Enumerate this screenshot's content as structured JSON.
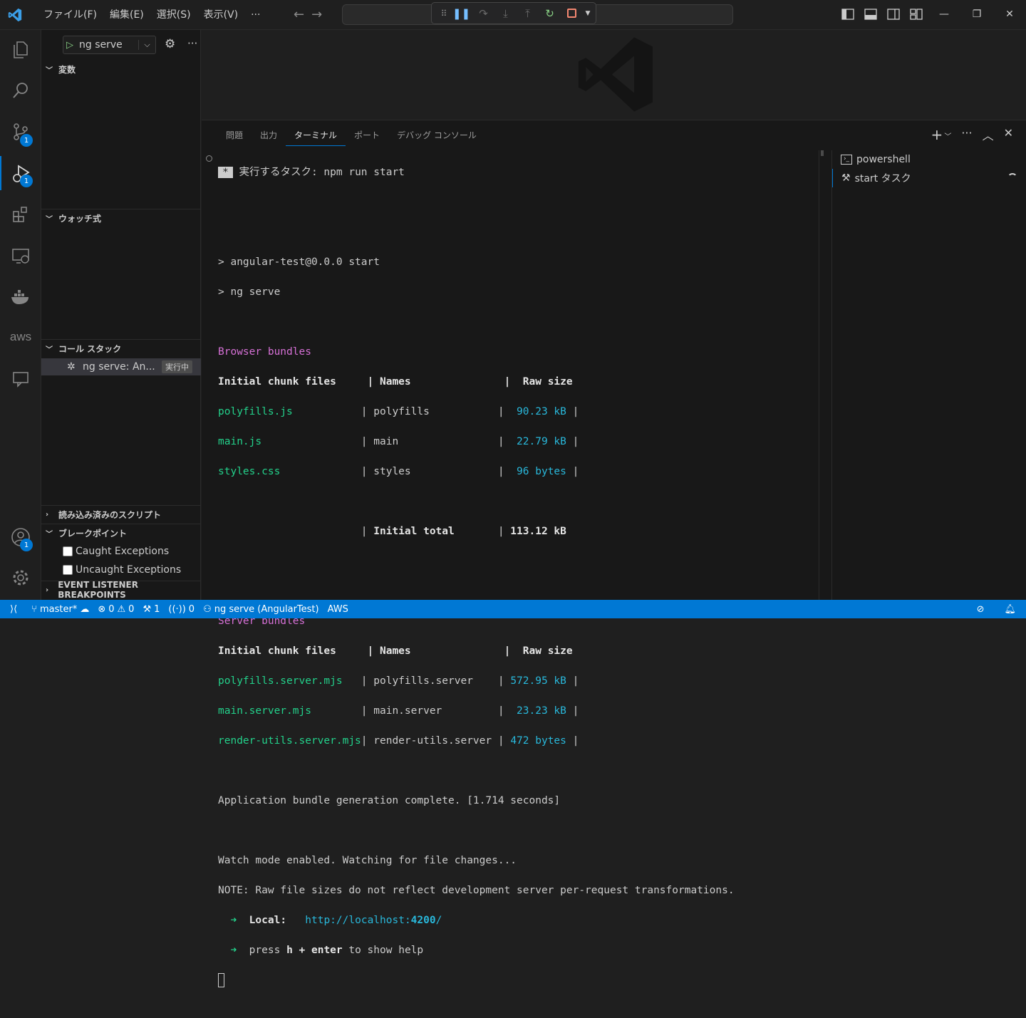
{
  "menu": [
    "ファイル(F)",
    "編集(E)",
    "選択(S)",
    "表示(V)",
    "···"
  ],
  "debug_toolbar": {
    "icons": [
      "gripper-icon",
      "pause-icon",
      "step-over-icon",
      "step-into-icon",
      "step-out-icon",
      "restart-icon",
      "stop-icon",
      "chevron-down-icon"
    ]
  },
  "window_controls": [
    "—",
    "❐",
    "✕"
  ],
  "activity": {
    "scm_badge": "1",
    "debug_badge": "1",
    "account_badge": "1",
    "aws_label": "aws"
  },
  "sidebar": {
    "run_config": "ng serve",
    "variables": "変数",
    "watch": "ウォッチ式",
    "call_stack": "コール スタック",
    "stack_item": "ng serve: An...",
    "stack_status": "実行中",
    "loaded_scripts": "読み込み済みのスクリプト",
    "breakpoints": "ブレークポイント",
    "bp_caught": "Caught Exceptions",
    "bp_uncaught": "Uncaught Exceptions",
    "event_listener": "EVENT LISTENER BREAKPOINTS"
  },
  "panel": {
    "tabs": [
      "問題",
      "出力",
      "ターミナル",
      "ポート",
      "デバッグ コンソール"
    ],
    "active_tab": "ターミナル"
  },
  "terminal": {
    "task_mark": "*",
    "task_line": " 実行するタスク: npm run start",
    "cmd1": "> angular-test@0.0.0 start",
    "cmd2": "> ng serve",
    "browser_bundles": "Browser bundles",
    "h_files": "Initial chunk files     ",
    "h_names": " Names               ",
    "h_raw": "  Raw size",
    "browser_rows": [
      {
        "file": "polyfills.js           ",
        "name": " polyfills           ",
        "size": "  90.23 kB"
      },
      {
        "file": "main.js                ",
        "name": " main                ",
        "size": "  22.79 kB"
      },
      {
        "file": "styles.css             ",
        "name": " styles              ",
        "size": "  96 bytes"
      }
    ],
    "initial_total_label": " Initial total       ",
    "initial_total_value": " 113.12 kB",
    "server_bundles": "Server bundles",
    "server_rows": [
      {
        "file": "polyfills.server.mjs   ",
        "name": " polyfills.server    ",
        "size": " 572.95 kB"
      },
      {
        "file": "main.server.mjs        ",
        "name": " main.server         ",
        "size": "  23.23 kB"
      },
      {
        "file": "render-utils.server.mjs",
        "name": " render-utils.server ",
        "size": " 472 bytes"
      }
    ],
    "complete": "Application bundle generation complete. [1.714 seconds]",
    "watch": "Watch mode enabled. Watching for file changes...",
    "note": "NOTE: Raw file sizes do not reflect development server per-request transformations.",
    "local_label": "Local:",
    "local_url_a": "http://localhost:",
    "local_url_port": "4200",
    "local_url_b": "/",
    "press": "press ",
    "press_key": "h + enter",
    "press_rest": " to show help"
  },
  "terminal_list": [
    "powershell",
    "start タスク"
  ],
  "status": {
    "branch": "master*",
    "errors": "0",
    "warnings": "0",
    "tools": "1",
    "ports": "0",
    "debug": "ng serve (AngularTest)",
    "aws": "AWS"
  },
  "colors": {
    "accent": "#0078d4",
    "green": "#23d18b",
    "cyan": "#29b8db",
    "magenta": "#d670d6"
  }
}
